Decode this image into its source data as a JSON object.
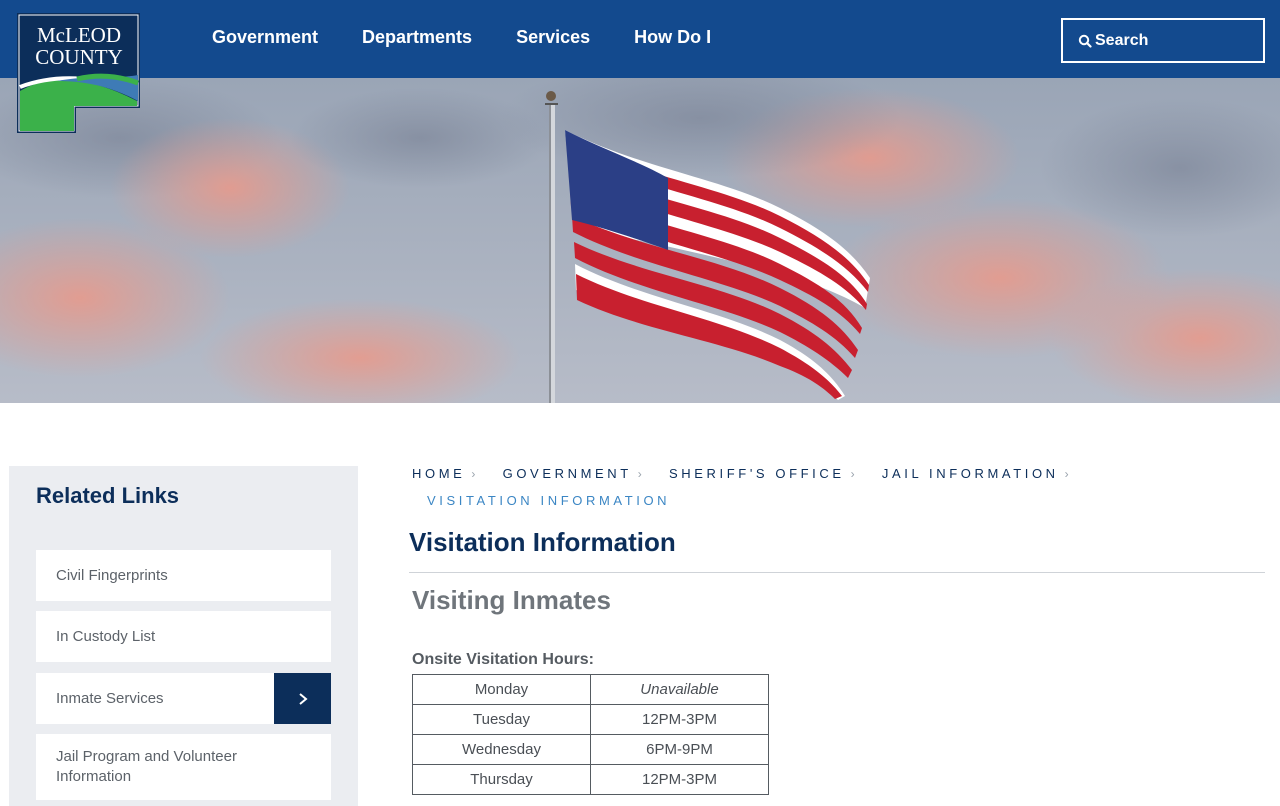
{
  "header": {
    "logo": {
      "line1": "McLEOD",
      "line2": "COUNTY"
    },
    "nav": [
      {
        "label": "Government"
      },
      {
        "label": "Departments"
      },
      {
        "label": "Services"
      },
      {
        "label": "How Do I"
      }
    ],
    "search": {
      "label": "Search",
      "icon": "search-icon"
    }
  },
  "colors": {
    "header_bg": "#134a8e",
    "brand_dark": "#0c2e5a",
    "breadcrumb_current": "#3b86c4",
    "sidebar_bg": "#ebedf1"
  },
  "sidebar": {
    "title": "Related Links",
    "items": [
      {
        "label": "Civil Fingerprints"
      },
      {
        "label": "In Custody List"
      },
      {
        "label": "Inmate Services",
        "has_arrow": true
      },
      {
        "label": "Jail Program and Volunteer Information"
      }
    ]
  },
  "breadcrumb": {
    "items": [
      {
        "label": "HOME"
      },
      {
        "label": "GOVERNMENT"
      },
      {
        "label": "SHERIFF'S OFFICE"
      },
      {
        "label": "JAIL INFORMATION"
      }
    ],
    "current": "VISITATION INFORMATION"
  },
  "main": {
    "title": "Visitation Information",
    "subtitle": "Visiting Inmates",
    "hours_label": "Onsite Visitation Hours:",
    "hours": [
      {
        "day": "Monday",
        "time": "Unavailable"
      },
      {
        "day": "Tuesday",
        "time": "12PM-3PM"
      },
      {
        "day": "Wednesday",
        "time": "6PM-9PM"
      },
      {
        "day": "Thursday",
        "time": "12PM-3PM"
      }
    ]
  }
}
